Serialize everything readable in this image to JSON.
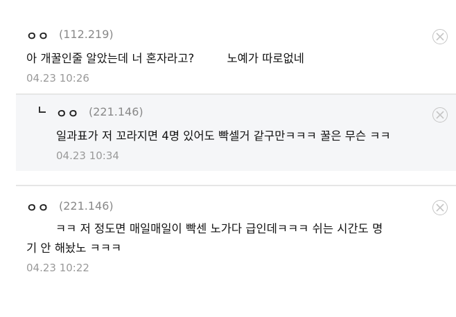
{
  "comments": [
    {
      "nickname": "ㅇㅇ",
      "ip": "(112.219)",
      "text": "아 개꿀인줄 알았는데 너 혼자라고?         노예가 따로없네",
      "date": "04.23 10:26"
    },
    {
      "nickname": "ㅇㅇ",
      "ip": "(221.146)",
      "text": "일과표가 저 꼬라지면 4명 있어도 빡셀거 같구만ㅋㅋㅋ 꿀은 무슨 ㅋㅋ",
      "date": "04.23 10:34",
      "is_reply": true
    },
    {
      "nickname": "ㅇㅇ",
      "ip": "(221.146)",
      "text_line1": "ㅋㅋ 저 정도면 매일매일이 빡센 노가다 급인데ㅋㅋㅋ 쉬는 시간도 명",
      "text_line2": "기 안 해놨노 ㅋㅋㅋ",
      "date": "04.23 10:22"
    }
  ],
  "icons": {
    "delete": "close-circle-icon",
    "reply": "reply-arrow-icon"
  }
}
